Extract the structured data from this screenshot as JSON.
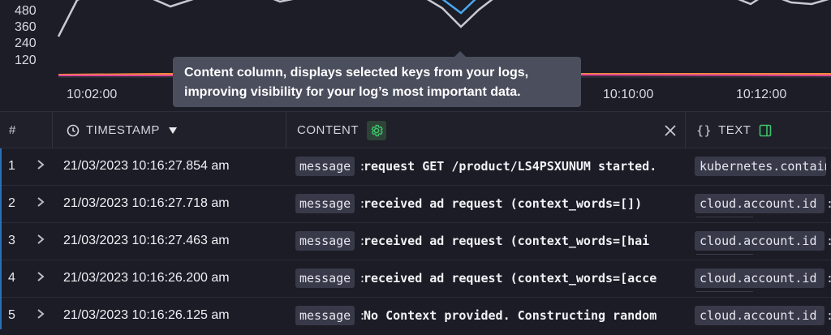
{
  "colors": {
    "accent_green": "#3fc46b",
    "tooltip_bg": "#4a4e5d",
    "pill_bg": "#383a4a"
  },
  "chart": {
    "y_ticks": [
      "480",
      "360",
      "240",
      "120"
    ],
    "x_ticks": [
      "10:02:00",
      "10:10:00",
      "10:12:00"
    ]
  },
  "tooltip": {
    "line1": "Content column, displays selected keys from your logs,",
    "line2": "improving visibility for your log’s most important data."
  },
  "table": {
    "headers": {
      "index": "#",
      "timestamp": "TIMESTAMP",
      "content": "CONTENT",
      "text": "TEXT"
    },
    "icons": {
      "clock": "clock-icon",
      "sort": "sort-desc-icon",
      "gear": "gear-icon",
      "close": "close-icon",
      "braces": "braces-icon",
      "panel": "panel-icon",
      "chevron": "chevron-right-icon"
    },
    "rows": [
      {
        "num": "1",
        "timestamp": "21/03/2023 10:16:27.854 am",
        "key": "message",
        "value": "request GET /product/LS4PSXUNUM started.",
        "text_key": "kubernetes.container"
      },
      {
        "num": "2",
        "timestamp": "21/03/2023 10:16:27.718 am",
        "key": "message",
        "value": "received ad request (context_words=[])",
        "text_key": "cloud.account.id"
      },
      {
        "num": "3",
        "timestamp": "21/03/2023 10:16:27.463 am",
        "key": "message",
        "value": "received ad request (context_words=[hai",
        "text_key": "cloud.account.id"
      },
      {
        "num": "4",
        "timestamp": "21/03/2023 10:16:26.200 am",
        "key": "message",
        "value": "received ad request (context_words=[acce",
        "text_key": "cloud.account.id"
      },
      {
        "num": "5",
        "timestamp": "21/03/2023 10:16:26.125 am",
        "key": "message",
        "value": "No Context provided. Constructing random",
        "text_key": "cloud.account.id"
      }
    ]
  }
}
